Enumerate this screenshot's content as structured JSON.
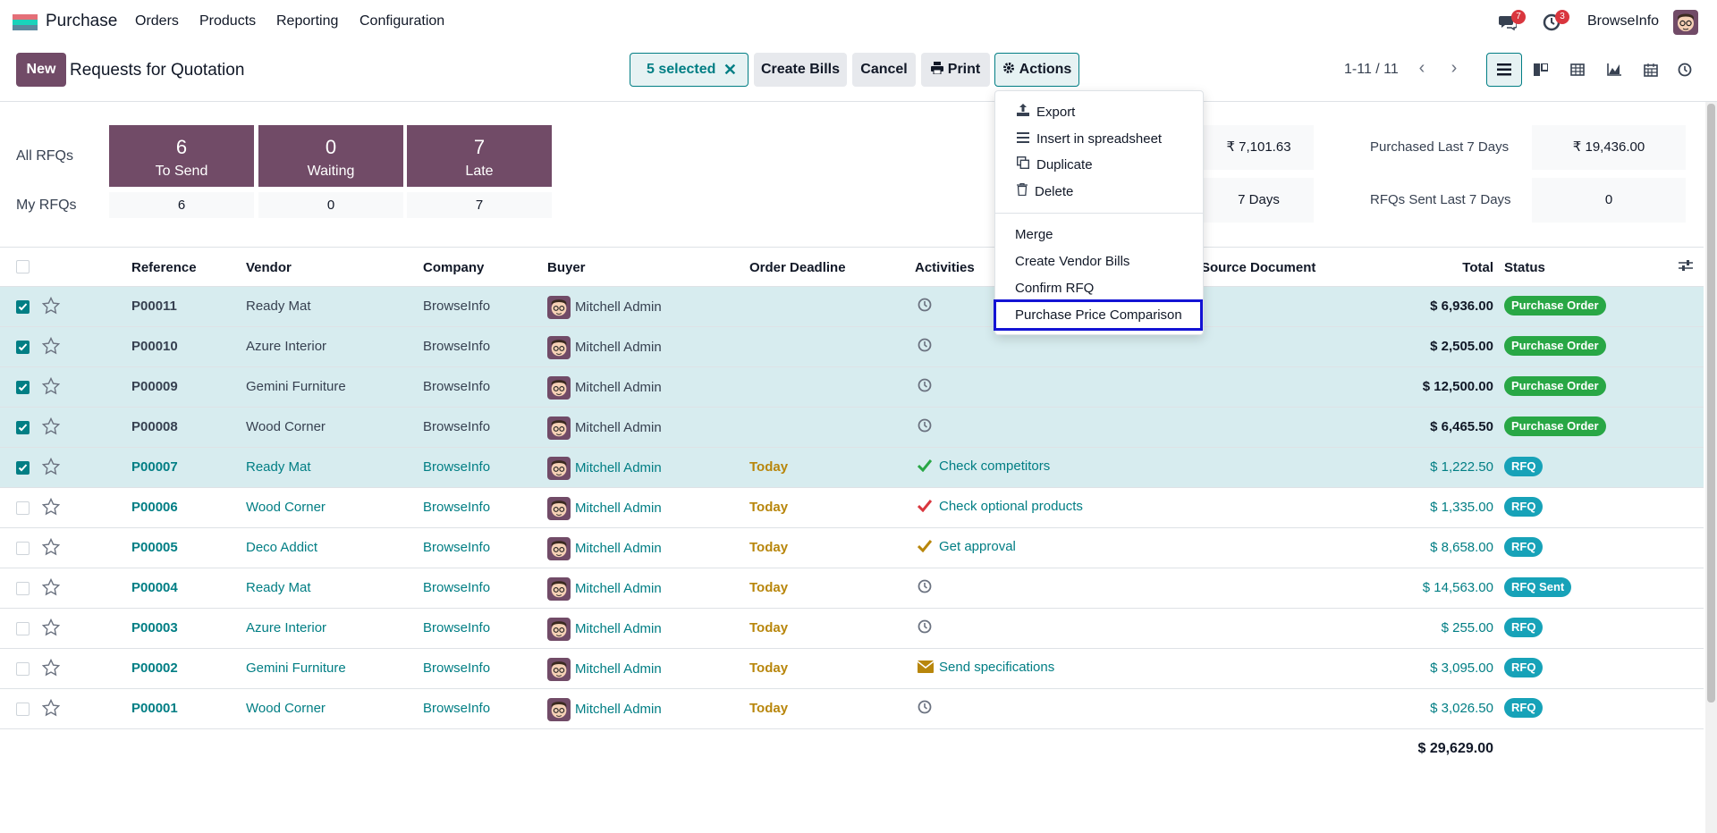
{
  "app": {
    "name": "Purchase"
  },
  "menu": [
    {
      "label": "Orders"
    },
    {
      "label": "Products"
    },
    {
      "label": "Reporting"
    },
    {
      "label": "Configuration"
    }
  ],
  "systray": {
    "messages_count": "7",
    "activities_count": "3",
    "company": "BrowseInfo"
  },
  "control": {
    "new_label": "New",
    "title": "Requests for Quotation",
    "selected_label": "5 selected",
    "create_bills": "Create Bills",
    "cancel": "Cancel",
    "print": "Print",
    "actions": "Actions",
    "pager": "1-11 / 11"
  },
  "dashboard": {
    "all_label": "All RFQs",
    "my_label": "My RFQs",
    "cards": [
      {
        "value": "6",
        "label": "To Send",
        "my": "6"
      },
      {
        "value": "0",
        "label": "Waiting",
        "my": "0"
      },
      {
        "value": "7",
        "label": "Late",
        "my": "7"
      }
    ],
    "right": {
      "avg_value": "₹ 7,101.63",
      "purchased_label": "Purchased Last 7 Days",
      "purchased_value": "₹ 19,436.00",
      "days_value": "7 Days",
      "sent_label": "RFQs Sent Last 7 Days",
      "sent_value": "0"
    }
  },
  "table": {
    "headers": {
      "reference": "Reference",
      "vendor": "Vendor",
      "company": "Company",
      "buyer": "Buyer",
      "deadline": "Order Deadline",
      "activities": "Activities",
      "source": "Source Document",
      "total": "Total",
      "status": "Status"
    },
    "rows": [
      {
        "ref": "P00011",
        "vendor": "Ready Mat",
        "company": "BrowseInfo",
        "buyer": "Mitchell Admin",
        "deadline": "",
        "activity": "",
        "total": "$ 6,936.00",
        "status": "Purchase Order",
        "checked": true
      },
      {
        "ref": "P00010",
        "vendor": "Azure Interior",
        "company": "BrowseInfo",
        "buyer": "Mitchell Admin",
        "deadline": "",
        "activity": "",
        "total": "$ 2,505.00",
        "status": "Purchase Order",
        "checked": true
      },
      {
        "ref": "P00009",
        "vendor": "Gemini Furniture",
        "company": "BrowseInfo",
        "buyer": "Mitchell Admin",
        "deadline": "",
        "activity": "",
        "total": "$ 12,500.00",
        "status": "Purchase Order",
        "checked": true
      },
      {
        "ref": "P00008",
        "vendor": "Wood Corner",
        "company": "BrowseInfo",
        "buyer": "Mitchell Admin",
        "deadline": "",
        "activity": "",
        "total": "$ 6,465.50",
        "status": "Purchase Order",
        "checked": true
      },
      {
        "ref": "P00007",
        "vendor": "Ready Mat",
        "company": "BrowseInfo",
        "buyer": "Mitchell Admin",
        "deadline": "Today",
        "activity": "Check competitors",
        "total": "$ 1,222.50",
        "status": "RFQ",
        "checked": true
      },
      {
        "ref": "P00006",
        "vendor": "Wood Corner",
        "company": "BrowseInfo",
        "buyer": "Mitchell Admin",
        "deadline": "Today",
        "activity": "Check optional products",
        "total": "$ 1,335.00",
        "status": "RFQ",
        "checked": false
      },
      {
        "ref": "P00005",
        "vendor": "Deco Addict",
        "company": "BrowseInfo",
        "buyer": "Mitchell Admin",
        "deadline": "Today",
        "activity": "Get approval",
        "total": "$ 8,658.00",
        "status": "RFQ",
        "checked": false
      },
      {
        "ref": "P00004",
        "vendor": "Ready Mat",
        "company": "BrowseInfo",
        "buyer": "Mitchell Admin",
        "deadline": "Today",
        "activity": "",
        "total": "$ 14,563.00",
        "status": "RFQ Sent",
        "checked": false
      },
      {
        "ref": "P00003",
        "vendor": "Azure Interior",
        "company": "BrowseInfo",
        "buyer": "Mitchell Admin",
        "deadline": "Today",
        "activity": "",
        "total": "$ 255.00",
        "status": "RFQ",
        "checked": false
      },
      {
        "ref": "P00002",
        "vendor": "Gemini Furniture",
        "company": "BrowseInfo",
        "buyer": "Mitchell Admin",
        "deadline": "Today",
        "activity": "Send specifications",
        "total": "$ 3,095.00",
        "status": "RFQ",
        "checked": false
      },
      {
        "ref": "P00001",
        "vendor": "Wood Corner",
        "company": "BrowseInfo",
        "buyer": "Mitchell Admin",
        "deadline": "Today",
        "activity": "",
        "total": "$ 3,026.50",
        "status": "RFQ",
        "checked": false
      }
    ],
    "grand_total": "$ 29,629.00"
  },
  "actions_menu": {
    "export": "Export",
    "spreadsheet": "Insert in spreadsheet",
    "duplicate": "Duplicate",
    "delete": "Delete",
    "merge": "Merge",
    "vendor_bills": "Create Vendor Bills",
    "confirm": "Confirm RFQ",
    "compare": "Purchase Price Comparison"
  },
  "colors": {
    "brand": "#714B67",
    "accent": "#017e84",
    "success": "#28a745",
    "info": "#17a2b8"
  }
}
